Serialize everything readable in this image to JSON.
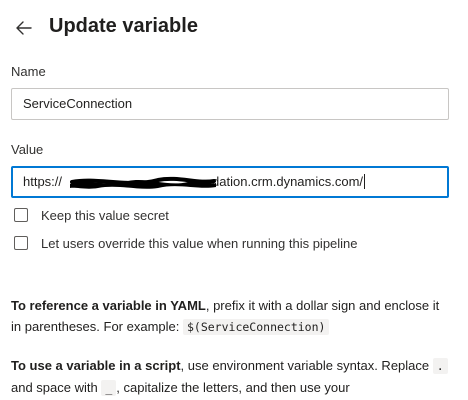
{
  "header": {
    "back_icon": "arrow-left-icon",
    "title": "Update variable"
  },
  "name_field": {
    "label": "Name",
    "value": "ServiceConnection"
  },
  "value_field": {
    "label": "Value",
    "value_prefix": "https://",
    "value_suffix": "dation.crm.dynamics.com/",
    "focus_color": "#0078d4"
  },
  "options": {
    "secret_label": "Keep this value secret",
    "secret_checked": false,
    "override_label": "Let users override this value when running this pipeline",
    "override_checked": false
  },
  "help": {
    "yaml_bold": "To reference a variable in YAML",
    "yaml_text": ", prefix it with a dollar sign and enclose it in parentheses. For example: ",
    "yaml_code": "$(ServiceConnection)",
    "script_bold": "To use a variable in a script",
    "script_text1": ", use environment variable syntax. Replace ",
    "script_code1": ".",
    "script_text2": " and space with ",
    "script_code2": "_",
    "script_text3": ", capitalize the letters, and then use your"
  }
}
